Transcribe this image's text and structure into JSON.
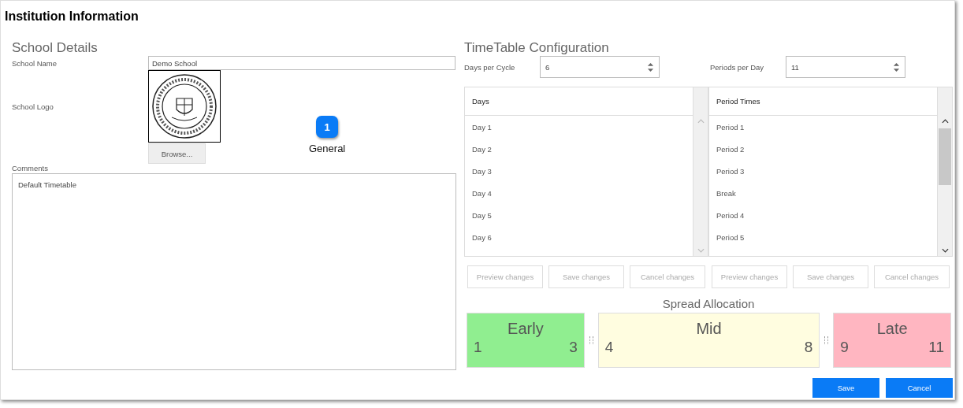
{
  "window": {
    "title": "Institution Information"
  },
  "school_details": {
    "heading": "School Details",
    "name_label": "School Name",
    "name_value": "Demo School",
    "logo_label": "School Logo",
    "browse_button": "Browse...",
    "comments_label": "Comments",
    "comments_value": "Default Timetable"
  },
  "marker": {
    "number": "1",
    "label": "General"
  },
  "timetable": {
    "heading": "TimeTable Configuration",
    "spinners": [
      {
        "label": "Days per Cycle",
        "value": "6"
      },
      {
        "label": "Periods per Day",
        "value": "11"
      }
    ],
    "grids": [
      {
        "header": "Days",
        "rows": [
          "Day 1",
          "Day 2",
          "Day 3",
          "Day 4",
          "Day 5",
          "Day 6"
        ],
        "thumb": false,
        "buttons": [
          "Preview changes",
          "Save changes",
          "Cancel changes"
        ]
      },
      {
        "header": "Period Times",
        "rows": [
          "Period 1",
          "Period 2",
          "Period 3",
          "Break",
          "Period 4",
          "Period 5"
        ],
        "thumb": true,
        "buttons": [
          "Preview changes",
          "Save changes",
          "Cancel changes"
        ]
      }
    ]
  },
  "spread": {
    "title": "Spread Allocation",
    "segments": [
      {
        "label": "Early",
        "from": "1",
        "to": "3",
        "color": "#90ee90"
      },
      {
        "label": "Mid",
        "from": "4",
        "to": "8",
        "color": "#fffde0"
      },
      {
        "label": "Late",
        "from": "9",
        "to": "11",
        "color": "#ffb6c1"
      }
    ]
  },
  "buttons": [
    "Save",
    "Cancel"
  ]
}
